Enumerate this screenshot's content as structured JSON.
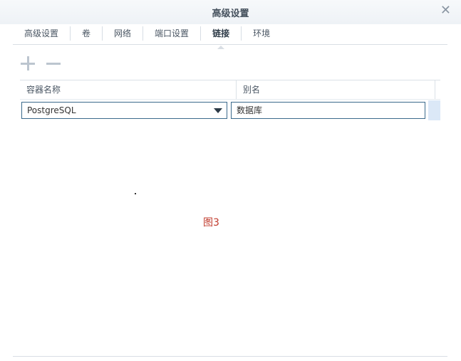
{
  "window": {
    "title": "高级设置"
  },
  "tabs": [
    {
      "label": "高级设置"
    },
    {
      "label": "卷"
    },
    {
      "label": "网络"
    },
    {
      "label": "端口设置"
    },
    {
      "label": "链接"
    },
    {
      "label": "环境"
    }
  ],
  "active_tab": "链接",
  "toolbar": {
    "add_icon": "plus-icon",
    "remove_icon": "minus-icon"
  },
  "table": {
    "columns": [
      "容器名称",
      "别名"
    ],
    "rows": [
      {
        "container": "PostgreSQL",
        "alias": "数据库"
      }
    ]
  },
  "caption": "图3",
  "colors": {
    "caption": "#c0392b",
    "input_border": "#3b6a8c",
    "row_highlight": "#dbe8f7"
  }
}
